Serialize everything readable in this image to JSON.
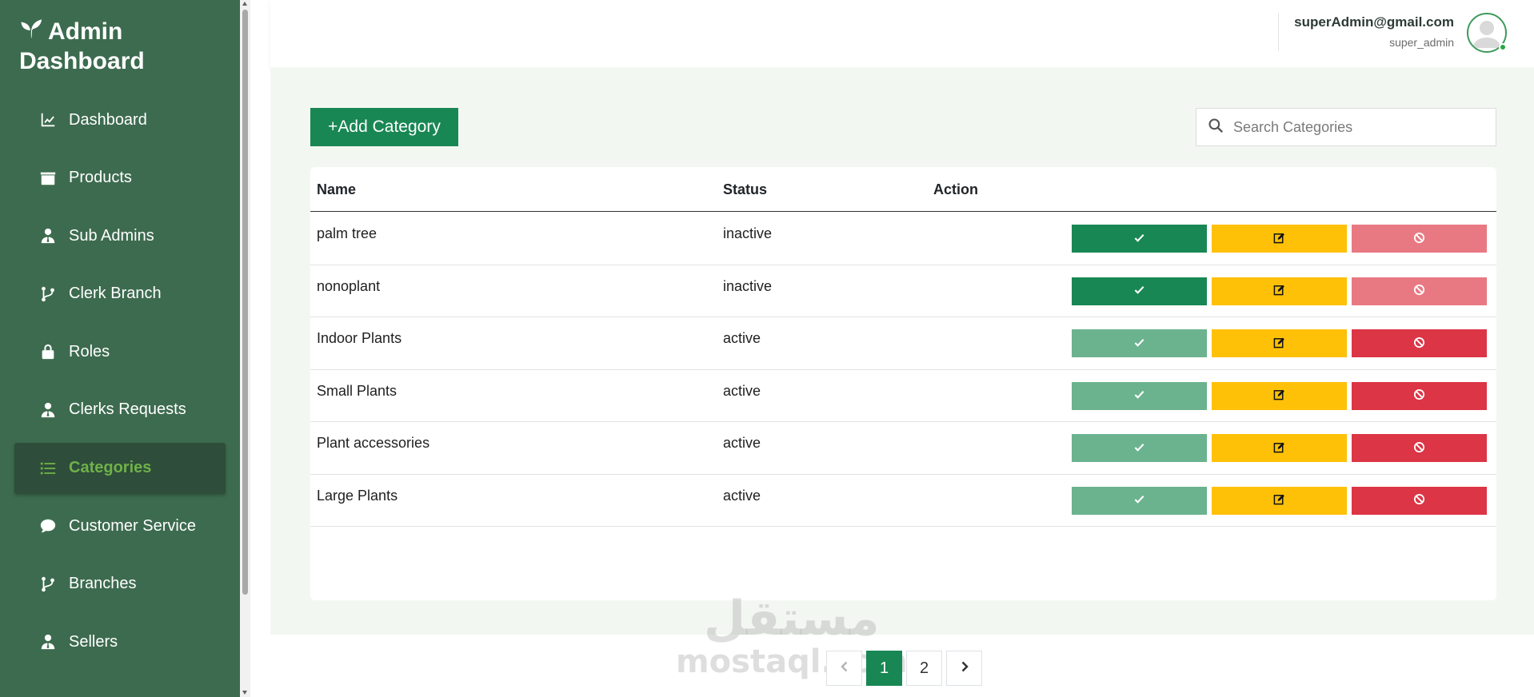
{
  "brand": {
    "line1": "Admin",
    "line2": "Dashboard",
    "icon": "leaf-icon"
  },
  "sidebar": {
    "items": [
      {
        "label": "Dashboard",
        "icon": "chart-line-icon",
        "active": false
      },
      {
        "label": "Products",
        "icon": "box-icon",
        "active": false
      },
      {
        "label": "Sub Admins",
        "icon": "user-tie-icon",
        "active": false
      },
      {
        "label": "Clerk Branch",
        "icon": "code-branch-icon",
        "active": false
      },
      {
        "label": "Roles",
        "icon": "lock-icon",
        "active": false
      },
      {
        "label": "Clerks Requests",
        "icon": "user-tie-icon",
        "active": false
      },
      {
        "label": "Categories",
        "icon": "list-icon",
        "active": true
      },
      {
        "label": "Customer Service",
        "icon": "comment-icon",
        "active": false
      },
      {
        "label": "Branches",
        "icon": "code-branch-icon",
        "active": false
      },
      {
        "label": "Sellers",
        "icon": "user-tie-icon",
        "active": false
      }
    ]
  },
  "header": {
    "email": "superAdmin@gmail.com",
    "role": "super_admin"
  },
  "toolbar": {
    "add_label": "+Add Category",
    "search_placeholder": "Search Categories"
  },
  "table": {
    "columns": [
      "Name",
      "Status",
      "Action"
    ],
    "rows": [
      {
        "name": "palm tree",
        "status": "inactive"
      },
      {
        "name": "nonoplant",
        "status": "inactive"
      },
      {
        "name": "Indoor Plants",
        "status": "active"
      },
      {
        "name": "Small Plants",
        "status": "active"
      },
      {
        "name": "Plant accessories",
        "status": "active"
      },
      {
        "name": "Large Plants",
        "status": "active"
      }
    ]
  },
  "pagination": {
    "pages": [
      "1",
      "2"
    ],
    "current": "1"
  },
  "watermark": {
    "arabic": "مستقل",
    "latin": "mostaql.com"
  },
  "colors": {
    "sidebar": "#3d6b4f",
    "sidebar_active": "#2e4d3a",
    "active_text": "#6fb14a",
    "primary": "#198754",
    "primary_faded": "#6bb38f",
    "warning": "#ffc107",
    "danger": "#dc3545",
    "danger_faded": "#e87983",
    "background": "#f3f7f2"
  }
}
